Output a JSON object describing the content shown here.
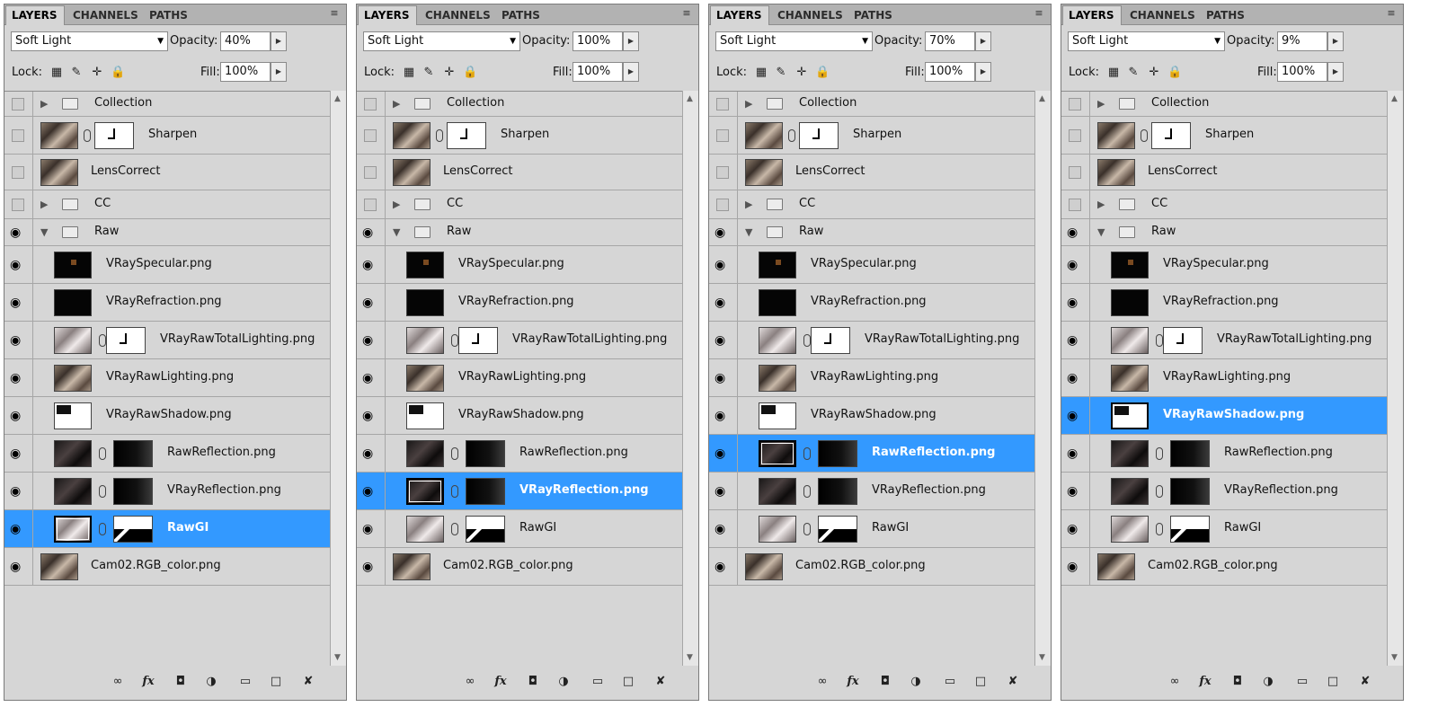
{
  "tabs": [
    "LAYERS",
    "CHANNELS",
    "PATHS"
  ],
  "labels": {
    "opacity": "Opacity:",
    "lock": "Lock:",
    "fill": "Fill:"
  },
  "icons": {
    "panel_menu": "panel-menu-icon",
    "lock": [
      "lock-transparent-icon",
      "lock-paint-icon",
      "lock-move-icon",
      "lock-all-icon"
    ],
    "bottom": [
      "link-layers-icon",
      "fx-icon",
      "add-mask-icon",
      "adjustment-layer-icon",
      "new-group-icon",
      "new-layer-icon",
      "delete-icon"
    ]
  },
  "colors": {
    "selection": "#3399ff",
    "panel": "#d6d6d6"
  },
  "panels": [
    {
      "blend_mode": "Soft Light",
      "opacity": "40%",
      "fill": "100%",
      "selected": "RawGI"
    },
    {
      "blend_mode": "Soft Light",
      "opacity": "100%",
      "fill": "100%",
      "selected": "VRayReflection.png"
    },
    {
      "blend_mode": "Soft Light",
      "opacity": "70%",
      "fill": "100%",
      "selected": "RawReflection.png"
    },
    {
      "blend_mode": "Soft Light",
      "opacity": "9%",
      "fill": "100%",
      "selected": "VRayRawShadow.png"
    }
  ],
  "layers": [
    {
      "name": "Collection",
      "kind": "group",
      "visible": false,
      "expanded": false
    },
    {
      "name": "Sharpen",
      "kind": "layer",
      "visible": false,
      "thumb": "photo",
      "mask": "white"
    },
    {
      "name": "LensCorrect",
      "kind": "layer",
      "visible": false,
      "thumb": "photo"
    },
    {
      "name": "CC",
      "kind": "group",
      "visible": false,
      "expanded": false
    },
    {
      "name": "Raw",
      "kind": "group",
      "visible": true,
      "expanded": true
    },
    {
      "name": "VRaySpecular.png",
      "kind": "child",
      "visible": true,
      "thumb": "specular"
    },
    {
      "name": "VRayRefraction.png",
      "kind": "child",
      "visible": true,
      "thumb": "black"
    },
    {
      "name": "VRayRawTotalLighting.png",
      "kind": "child",
      "visible": true,
      "thumb": "gray",
      "mask": "white"
    },
    {
      "name": "VRayRawLighting.png",
      "kind": "child",
      "visible": true,
      "thumb": "photo"
    },
    {
      "name": "VRayRawShadow.png",
      "kind": "child",
      "visible": true,
      "thumb": "shadow"
    },
    {
      "name": "RawReflection.png",
      "kind": "child",
      "visible": true,
      "thumb": "dark",
      "mask": "blackm"
    },
    {
      "name": "VRayReflection.png",
      "kind": "child",
      "visible": true,
      "thumb": "dark",
      "mask": "blackm"
    },
    {
      "name": "RawGI",
      "kind": "child",
      "visible": true,
      "thumb": "gray",
      "mask": "gimask"
    },
    {
      "name": "Cam02.RGB_color.png",
      "kind": "layer",
      "visible": true,
      "thumb": "photo"
    }
  ]
}
